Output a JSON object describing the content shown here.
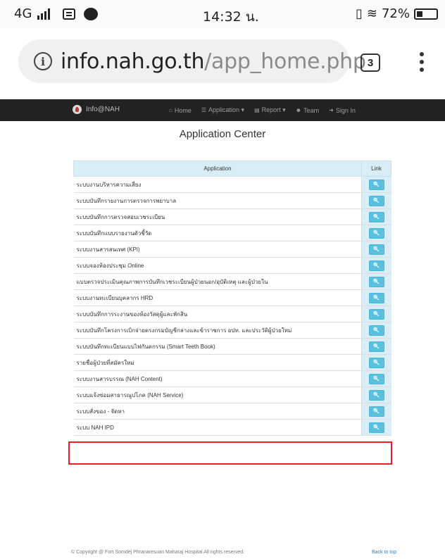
{
  "status_bar": {
    "network": "4G",
    "time": "14:32 น.",
    "battery": "72%"
  },
  "browser": {
    "url_host": "info.nah.go.th",
    "url_path": "/app_home.php",
    "tab_count": "3"
  },
  "navbar": {
    "brand": "Info@NAH",
    "items": [
      {
        "label": "Home",
        "icon": "home-icon",
        "glyph": "⌂"
      },
      {
        "label": "Application ▾",
        "icon": "list-icon",
        "glyph": "☰"
      },
      {
        "label": "Report ▾",
        "icon": "file-icon",
        "glyph": "▤"
      },
      {
        "label": "Team",
        "icon": "users-icon",
        "glyph": "☻"
      },
      {
        "label": "Sign In",
        "icon": "sign-in-icon",
        "glyph": "➜"
      }
    ]
  },
  "page_title": "Application Center",
  "table": {
    "headers": {
      "application": "Application",
      "link": "Link"
    },
    "rows": [
      "ระบบงานบริหารความเสี่ยง",
      "ระบบบันทึกรายงานการตรวจการพยาบาล",
      "ระบบบันทึกการตรวจสอบเวชระเบียน",
      "ระบบบันทึกแบบรายงานตัวชี้วัด",
      "ระบบงานสารสนเทศ (KPI)",
      "ระบบจองห้องประชุม Online",
      "แบบตรวจประเมินคุณภาพการบันทึกเวชระเบียนผู้ป่วยนอก/อุบัติเหตุ และผู้ป่วยใน",
      "ระบบงานทะเบียนบุคลากร HRD",
      "ระบบบันทึกการระงานของห้องวัสดุผู้และพักสิน",
      "ระบบบันทึกโครงการเบิกจ่ายตรงกรมบัญชีกลางและข้าราชการ อปท. และประวัติผู้ป่วยใหม่",
      "ระบบบันทึกทะเบียนแบบไฟกันตกรรม (Smart Teeth Book)",
      "รายชื่อผู้ป่วยที่สมัครใหม่",
      "ระบบงานสารบรรณ (NAH Content)",
      "ระบบแจ้งซ่อมสาธารณูปโภค (NAH Service)",
      "ระบบสั่งของ - จัดหา",
      "ระบบ NAH IPD"
    ],
    "link_icon": "search-icon",
    "link_glyph": "🔍"
  },
  "highlight_color": "#e32222",
  "footer": {
    "copyright": "© Copyright @ Fort Somdej Phranaresuan Maharaj Hospital All rights reserved.",
    "back_to_top": "Back to top"
  }
}
